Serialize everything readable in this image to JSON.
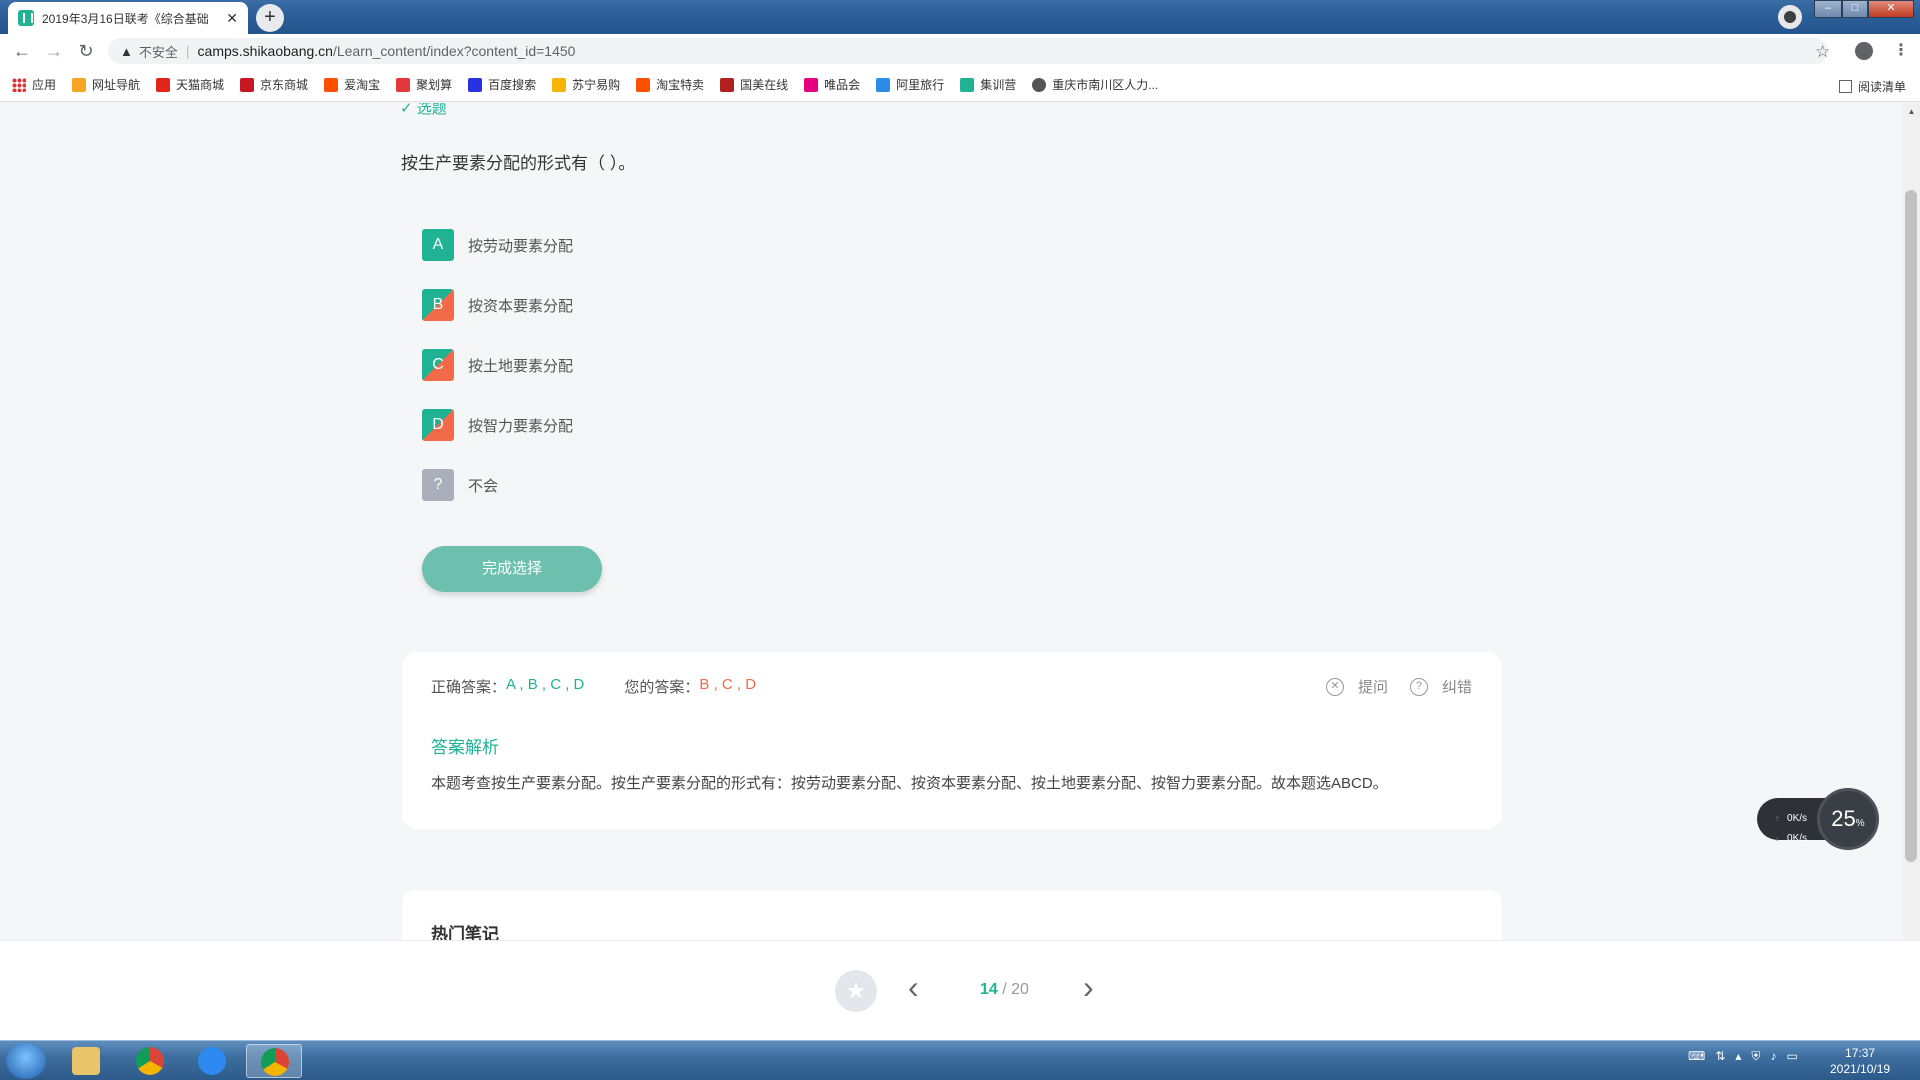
{
  "browser": {
    "tab_title": "2019年3月16日联考《综合基础",
    "tab_close": "✕",
    "new_tab": "+",
    "insecure_label": "不安全",
    "url_host": "camps.shikaobang.cn",
    "url_path": "/Learn_content/index?content_id=1450",
    "bookmarks": [
      {
        "label": "应用",
        "color": "#d33"
      },
      {
        "label": "网址导航",
        "color": "#f5a623"
      },
      {
        "label": "天猫商城",
        "color": "#e1251b"
      },
      {
        "label": "京东商城",
        "color": "#c81623"
      },
      {
        "label": "爱淘宝",
        "color": "#ff5000"
      },
      {
        "label": "聚划算",
        "color": "#e4393c"
      },
      {
        "label": "百度搜索",
        "color": "#2932e1"
      },
      {
        "label": "苏宁易购",
        "color": "#f7b500"
      },
      {
        "label": "淘宝特卖",
        "color": "#ff5000"
      },
      {
        "label": "国美在线",
        "color": "#b0201e"
      },
      {
        "label": "唯品会",
        "color": "#e4007f"
      },
      {
        "label": "阿里旅行",
        "color": "#2a8ce8"
      },
      {
        "label": "集训营",
        "color": "#1fb394"
      },
      {
        "label": "重庆市南川区人力...",
        "color": "#555555"
      }
    ],
    "reading_list": "阅读清单"
  },
  "page": {
    "partial_header": "✓ 选题",
    "question": "按生产要素分配的形式有（ ）。",
    "options": [
      {
        "letter": "A",
        "text": "按劳动要素分配",
        "state": "correct"
      },
      {
        "letter": "B",
        "text": "按资本要素分配",
        "state": "split"
      },
      {
        "letter": "C",
        "text": "按土地要素分配",
        "state": "split"
      },
      {
        "letter": "D",
        "text": "按智力要素分配",
        "state": "split"
      },
      {
        "letter": "?",
        "text": "不会",
        "state": "unknown"
      }
    ],
    "finish_button": "完成选择",
    "answer": {
      "correct_label": "正确答案：",
      "correct_value": "A , B , C , D",
      "yours_label": "您的答案：",
      "yours_value": "B , C , D",
      "ask_label": "提问",
      "report_label": "纠错",
      "analysis_title": "答案解析",
      "analysis_text": "本题考查按生产要素分配。按生产要素分配的形式有：按劳动要素分配、按资本要素分配、按土地要素分配、按智力要素分配。故本题选ABCD。"
    },
    "notes_title": "热门笔记",
    "pager": {
      "current": "14",
      "separator": " / ",
      "total": "20"
    }
  },
  "speed_widget": {
    "up": "0",
    "down": "0",
    "unit": "K/s",
    "percent": "25",
    "percent_sign": "%"
  },
  "taskbar": {
    "time": "17:37",
    "date": "2021/10/19"
  },
  "colors": {
    "accent": "#1fb394",
    "wrong": "#f36a4a"
  }
}
